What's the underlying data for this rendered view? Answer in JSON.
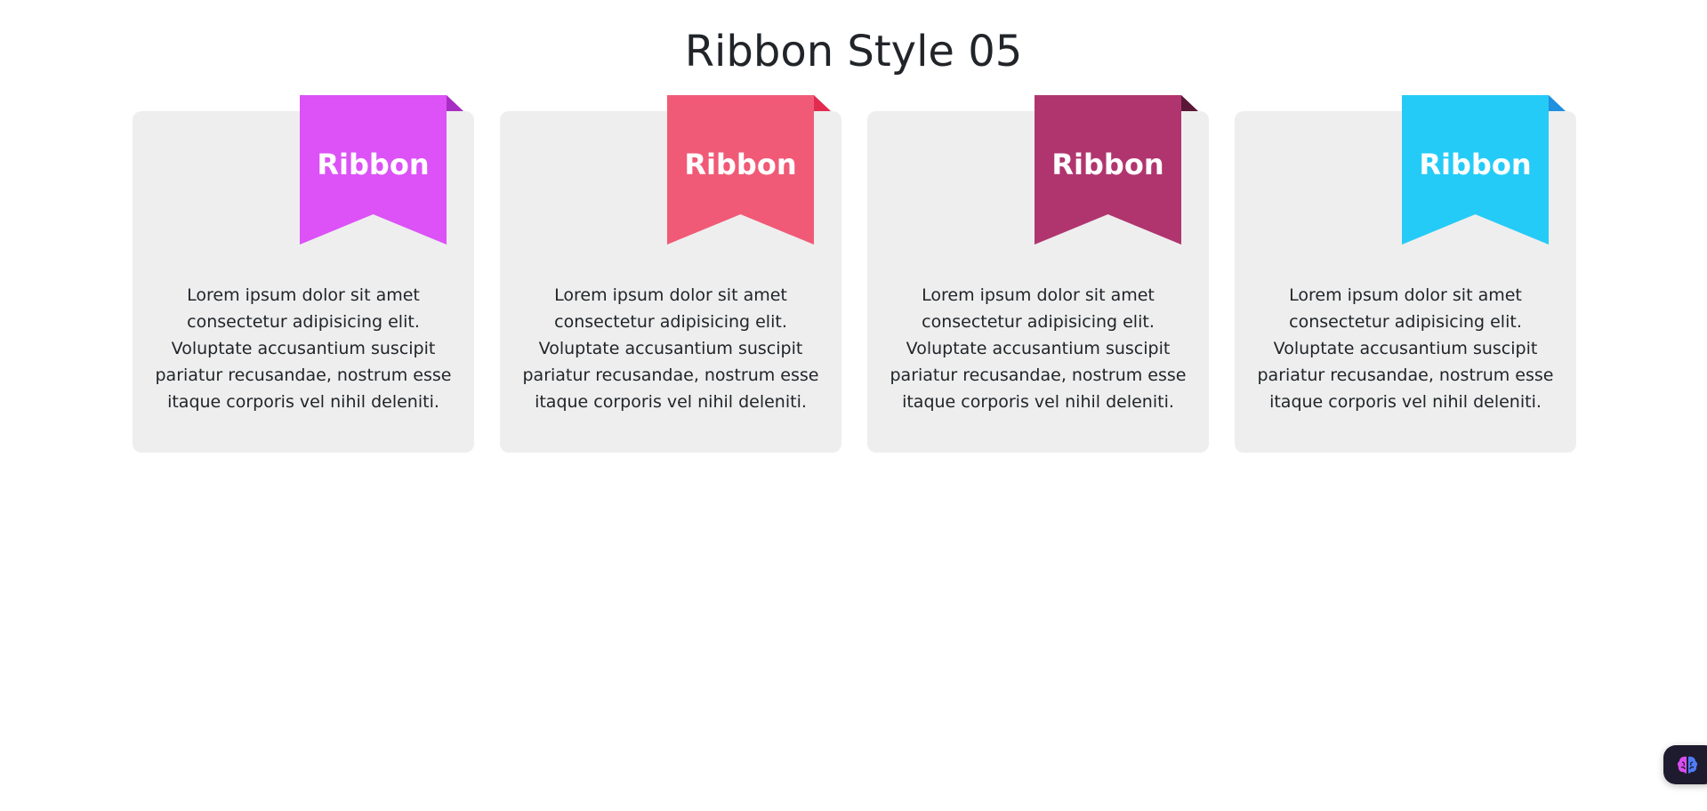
{
  "page": {
    "title": "Ribbon Style 05"
  },
  "cards": [
    {
      "ribbon_label": "Ribbon",
      "ribbon_color": "#dc52f7",
      "fold_color": "#a72ec3",
      "text": "Lorem ipsum dolor sit amet consectetur adipisicing elit. Voluptate accusantium suscipit pariatur recusandae, nostrum esse itaque corporis vel nihil deleniti."
    },
    {
      "ribbon_label": "Ribbon",
      "ribbon_color": "#f05a76",
      "fold_color": "#e12b4f",
      "text": "Lorem ipsum dolor sit amet consectetur adipisicing elit. Voluptate accusantium suscipit pariatur recusandae, nostrum esse itaque corporis vel nihil deleniti."
    },
    {
      "ribbon_label": "Ribbon",
      "ribbon_color": "#b0356f",
      "fold_color": "#5a1736",
      "text": "Lorem ipsum dolor sit amet consectetur adipisicing elit. Voluptate accusantium suscipit pariatur recusandae, nostrum esse itaque corporis vel nihil deleniti."
    },
    {
      "ribbon_label": "Ribbon",
      "ribbon_color": "#25cbf7",
      "fold_color": "#1f8fe0",
      "text": "Lorem ipsum dolor sit amet consectetur adipisicing elit. Voluptate accusantium suscipit pariatur recusandae, nostrum esse itaque corporis vel nihil deleniti."
    }
  ],
  "assistant_button": {
    "icon": "brain-icon"
  }
}
